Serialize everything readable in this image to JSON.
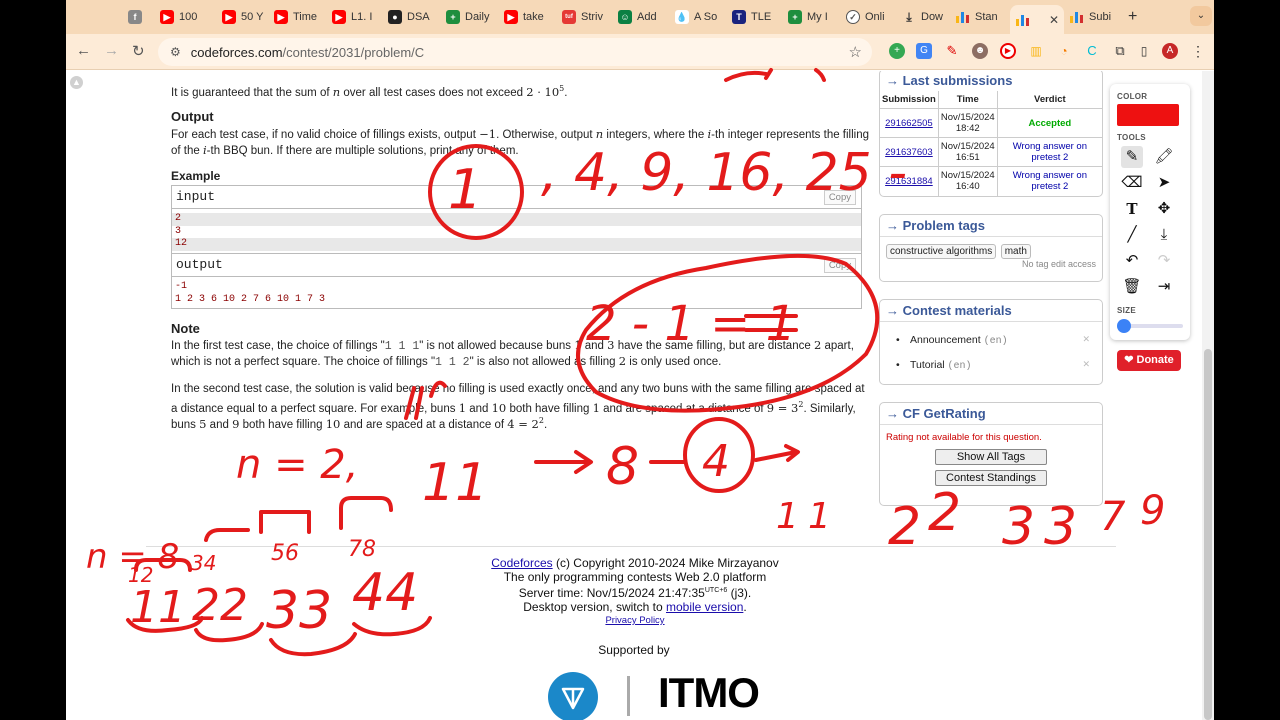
{
  "browser": {
    "tabs": [
      {
        "label": "",
        "icon": "facebook-icon",
        "color": "#888888"
      },
      {
        "label": "100",
        "icon": "youtube-icon",
        "color": "#ff0000"
      },
      {
        "label": "50 Y",
        "icon": "youtube-icon",
        "color": "#ff0000"
      },
      {
        "label": "Time",
        "icon": "youtube-icon",
        "color": "#ff0000"
      },
      {
        "label": "L1. I",
        "icon": "youtube-icon",
        "color": "#ff0000"
      },
      {
        "label": "DSA",
        "icon": "github-icon",
        "color": "#222222"
      },
      {
        "label": "Daily",
        "icon": "sheets-icon",
        "color": "#1e8e3e"
      },
      {
        "label": "take",
        "icon": "youtube-icon",
        "color": "#ff0000"
      },
      {
        "label": "Striv",
        "icon": "tuf-icon",
        "color": "#e53935"
      },
      {
        "label": "Add",
        "icon": "contacts-icon",
        "color": "#0b8043"
      },
      {
        "label": "A So",
        "icon": "drop-icon",
        "color": "#4a90d9"
      },
      {
        "label": "TLE",
        "icon": "tle-icon",
        "color": "#1a237e"
      },
      {
        "label": "My I",
        "icon": "sheets-icon",
        "color": "#1e8e3e"
      },
      {
        "label": "Onli",
        "icon": "check-icon",
        "color": "#555555"
      },
      {
        "label": "Dow",
        "icon": "download-icon",
        "color": "#333333"
      },
      {
        "label": "Stan",
        "icon": "codeforces-icon",
        "color": "#1e88e5"
      },
      {
        "label": "",
        "icon": "codeforces-icon",
        "color": "#1e88e5",
        "active": true
      },
      {
        "label": "Subi",
        "icon": "codeforces-icon",
        "color": "#1e88e5"
      }
    ],
    "new_tab": "+",
    "url_host": "codeforces.com",
    "url_path": "/contest/2031/problem/C",
    "profile_initial": "A"
  },
  "problem": {
    "guarantee_pre": "It is guaranteed that the sum of",
    "guarantee_var": "n",
    "guarantee_post": "over all test cases does not exceed",
    "guarantee_bound": "2 · 10",
    "guarantee_exp": "5",
    "output_title": "Output",
    "output_line1_a": "For each test case, if no valid choice of fillings exists, output",
    "output_line1_m": "−1",
    "output_line1_b": ". Otherwise, output",
    "output_line1_n": "n",
    "output_line1_c": "integers, where the",
    "output_line1_i": "i",
    "output_line1_d": "-th integer represents the filling",
    "output_line2_a": "of the",
    "output_line2_i": "i",
    "output_line2_b": "-th BBQ bun. If there are multiple solutions, print any of them.",
    "example_title": "Example",
    "input_label": "input",
    "output_label": "output",
    "copy_label": "Copy",
    "input_lines": [
      "2",
      "3",
      "12"
    ],
    "output_lines": [
      "-1",
      "1 2 3 6 10 2 7 6 10 1 7 3"
    ],
    "note_title": "Note",
    "note1_a": "In the first test case, the choice of fillings \"",
    "note1_code": "1 1 1",
    "note1_b": "\" is not allowed because buns",
    "note1_v1": "1",
    "note1_c": "and",
    "note1_v3": "3",
    "note1_d": "have the same filling, but are distance",
    "note1_v2": "2",
    "note1_e": "apart,",
    "note2_a": "which is not a perfect square. The choice of fillings \"",
    "note2_code": "1 1 2",
    "note2_b": "\" is also not allowed as filling",
    "note2_v": "2",
    "note2_c": "is only used once.",
    "note3": "In the second test case, the solution is valid because no filling is used exactly once, and any two buns with the same filling are spaced at",
    "note4_a": "a distance equal to a perfect square. For example, buns",
    "note4_v1": "1",
    "note4_b": "and",
    "note4_v10": "10",
    "note4_c": "both have filling",
    "note4_f": "1",
    "note4_d": "and are spaced at a distance of",
    "note4_m": "9 = 3",
    "note4_exp": "2",
    "note4_e": ". Similarly,",
    "note5_a": "buns",
    "note5_v5": "5",
    "note5_b": "and",
    "note5_v9": "9",
    "note5_c": "both have filling",
    "note5_f": "10",
    "note5_d": "and are spaced at a distance of",
    "note5_m": "4 = 2",
    "note5_exp": "2",
    "note5_e": "."
  },
  "sidebar": {
    "last_submissions_title": "→ Last submissions",
    "columns": [
      "Submission",
      "Time",
      "Verdict"
    ],
    "rows": [
      {
        "id": "291662505",
        "date": "Nov/15/2024",
        "time": "18:42",
        "verdict": "Accepted",
        "ok": true
      },
      {
        "id": "291637603",
        "date": "Nov/15/2024",
        "time": "16:51",
        "verdict": "Wrong answer on pretest 2",
        "ok": false
      },
      {
        "id": "291631884",
        "date": "Nov/15/2024",
        "time": "16:40",
        "verdict": "Wrong answer on pretest 2",
        "ok": false
      }
    ],
    "tags_title": "→ Problem tags",
    "tags": [
      "constructive algorithms",
      "math"
    ],
    "tags_note": "No tag edit access",
    "materials_title": "→ Contest materials",
    "materials": [
      {
        "label": "Announcement",
        "lang": "(en)"
      },
      {
        "label": "Tutorial",
        "lang": "(en)"
      }
    ],
    "getrating_title": "→ CF GetRating",
    "getrating_msg": "Rating not available for this question.",
    "btn_tags": "Show All Tags",
    "btn_standings": "Contest Standings"
  },
  "drawtool": {
    "color_label": "COLOR",
    "tools_label": "TOOLS",
    "size_label": "SIZE",
    "current_color": "#ee1111"
  },
  "donate_label": "Donate",
  "footer": {
    "brand": "Codeforces",
    "copyright": "(c) Copyright 2010-2024 Mike Mirzayanov",
    "tagline": "The only programming contests Web 2.0 platform",
    "server_time_label": "Server time: Nov/15/2024 21:47:35",
    "utc": "UTC+6",
    "server_suffix": "(j3).",
    "desktop_a": "Desktop version, switch to",
    "mobile_link": "mobile version",
    "desktop_b": ".",
    "privacy": "Privacy Policy",
    "supported_by": "Supported by",
    "itmo": "ITMO"
  },
  "annotations": {
    "squares": "1, 4, 9, 16, 25 -",
    "diff": "2 - 1 = 1",
    "n_eq_2": "n = 2,",
    "eleven": "11",
    "eight": "8",
    "four": "4",
    "n_eq_8": "n = 8",
    "pairs_top": [
      "12",
      "34",
      "56",
      "78"
    ],
    "pairs_bottom": [
      "11",
      "22",
      "33",
      "44"
    ],
    "right_seq": [
      "1",
      "1",
      "2",
      "2",
      "3",
      "3",
      "7",
      "9"
    ]
  }
}
